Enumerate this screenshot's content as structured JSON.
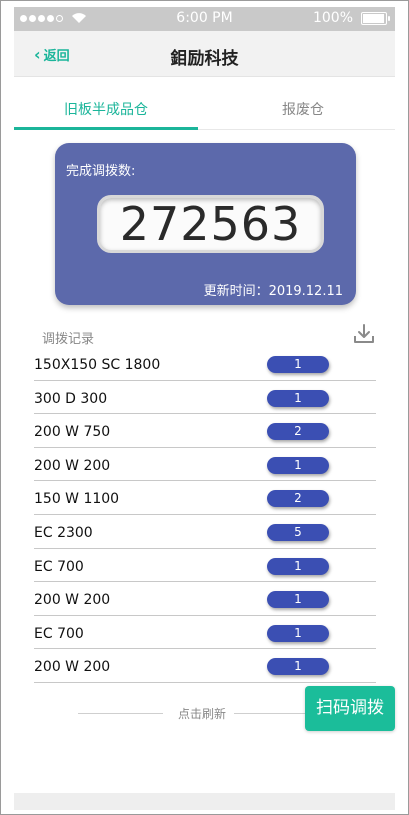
{
  "status_bar": {
    "time": "6:00 PM",
    "battery": "100%",
    "battery_level": 1.0,
    "signal_icon": "signal-dots-icon",
    "wifi_icon": "wifi-icon"
  },
  "navbar": {
    "back_label": "返回",
    "title": "鉬励科技"
  },
  "tabs": [
    {
      "label": "旧板半成品仓",
      "active": true
    },
    {
      "label": "报废仓",
      "active": false
    }
  ],
  "summary": {
    "label": "完成调拨数:",
    "count": "272563",
    "updated": "更新时间：2019.12.11"
  },
  "records": {
    "section_title": "调拨记录",
    "download_icon": "download-icon",
    "items": [
      {
        "name": "150X150 SC 1800",
        "qty": "1"
      },
      {
        "name": "300 D 300",
        "qty": "1"
      },
      {
        "name": "200 W 750",
        "qty": "2"
      },
      {
        "name": "200 W 200",
        "qty": "1"
      },
      {
        "name": "150 W 1100",
        "qty": "2"
      },
      {
        "name": "EC 2300",
        "qty": "5"
      },
      {
        "name": "EC 700",
        "qty": "1"
      },
      {
        "name": "200 W 200",
        "qty": "1"
      },
      {
        "name": "EC 700",
        "qty": "1"
      },
      {
        "name": "200 W 200",
        "qty": "1"
      }
    ]
  },
  "refresh_label": "点击刷新",
  "scan_button_label": "扫码调拨",
  "colors": {
    "accent": "#1bb59a",
    "card": "#5c69ab",
    "badge": "#3b4fb3"
  }
}
